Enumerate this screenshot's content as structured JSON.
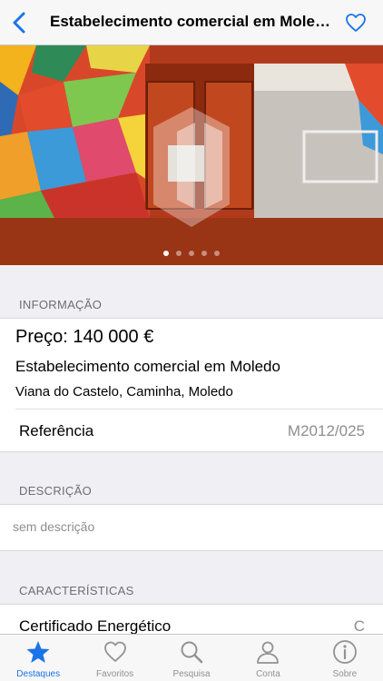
{
  "nav": {
    "title": "Estabelecimento comercial em Moledo",
    "back_icon": "chevron-left-icon",
    "favorite_icon": "heart-outline-icon"
  },
  "gallery": {
    "photo_count": 5,
    "active_index": 0
  },
  "info": {
    "header": "INFORMAÇÃO",
    "price": "Preço: 140 000 €",
    "title": "Estabelecimento comercial em Moledo",
    "location": "Viana do Castelo, Caminha, Moledo",
    "reference_label": "Referência",
    "reference_value": "M2012/025"
  },
  "description": {
    "header": "DESCRIÇÃO",
    "text": "sem descrição"
  },
  "features": {
    "header": "CARACTERÍSTICAS",
    "cert_label": "Certificado Energético",
    "cert_value": "C"
  },
  "tabs": [
    {
      "label": "Destaques",
      "icon": "star-icon",
      "active": true
    },
    {
      "label": "Favoritos",
      "icon": "heart-icon",
      "active": false
    },
    {
      "label": "Pesquisa",
      "icon": "search-icon",
      "active": false
    },
    {
      "label": "Conta",
      "icon": "person-icon",
      "active": false
    },
    {
      "label": "Sobre",
      "icon": "info-icon",
      "active": false
    }
  ],
  "colors": {
    "accent": "#1a73e8",
    "tab_inactive": "#929292",
    "background": "#efeff4"
  }
}
